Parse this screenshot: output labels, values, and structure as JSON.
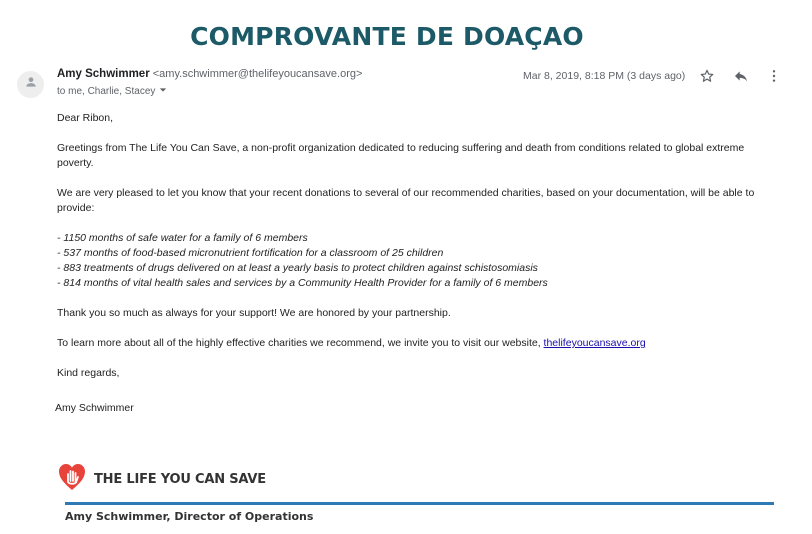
{
  "page_title": "COMPROVANTE DE DOAÇAO",
  "email": {
    "sender_name": "Amy Schwimmer",
    "sender_email": "<amy.schwimmer@thelifeyoucansave.org>",
    "recipients": "to me, Charlie, Stacey",
    "date": "Mar 8, 2019, 8:18 PM (3 days ago)",
    "icons": [
      "star-icon",
      "reply-icon",
      "more-vert-icon",
      "avatar-icon",
      "chevron-down-icon"
    ],
    "body": {
      "greeting": "Dear Ribon,",
      "intro": "Greetings from The Life You Can Save, a non-profit organization dedicated to reducing suffering and death from conditions related to global extreme poverty.",
      "pleased": "We are very pleased to let you know that your recent donations to several of our recommended charities, based on your documentation, will be able to provide:",
      "list": [
        "- 1150 months of safe water for a family of 6 members",
        "- 537 months of food-based micronutrient fortification for a classroom of 25 children",
        "- 883 treatments of drugs delivered on at least a yearly basis to protect children against schistosomiasis",
        "- 814 months of vital health sales and services by a Community Health Provider for a family of 6 members"
      ],
      "thanks": "Thank you so much as always for your support! We are honored by your partnership.",
      "learn_prefix": "To learn more about all of the highly effective charities we recommend, we invite you to visit our website, ",
      "learn_link": "thelifeyoucansave.org",
      "closing": "Kind regards,",
      "signature_name": "Amy Schwimmer"
    },
    "signature": {
      "logo_text": "THE LIFE YOU CAN SAVE",
      "title": "Amy Schwimmer, Director of Operations"
    }
  },
  "colors": {
    "title": "#1b5a66",
    "link": "#1a0dab",
    "rule": "#2f79b5",
    "logo_heart": "#e8433a"
  }
}
